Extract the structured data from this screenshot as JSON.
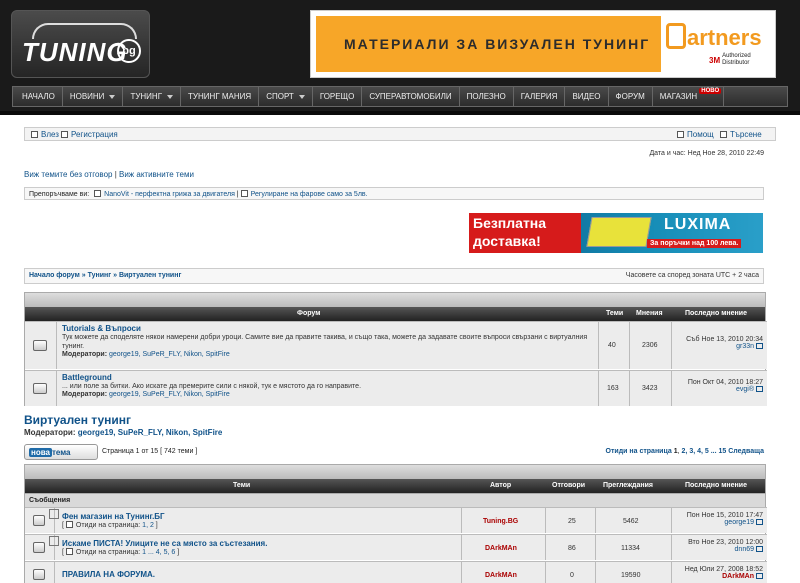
{
  "logo": {
    "text": "TUNING",
    "badge": "bg"
  },
  "banner": {
    "text": "МАТЕРИАЛИ ЗА ВИЗУАЛЕН ТУНИНГ",
    "brand": "artners",
    "brand_sub_strong": "3M",
    "brand_sub": "Authorized Distributor"
  },
  "nav": {
    "items": [
      {
        "label": "НАЧАЛО"
      },
      {
        "label": "НОВИНИ"
      },
      {
        "label": "ТУНИНГ"
      },
      {
        "label": "ТУНИНГ МАНИЯ"
      },
      {
        "label": "СПОРТ"
      },
      {
        "label": "ГОРЕЩО"
      },
      {
        "label": "СУПЕРАВТОМОБИЛИ"
      },
      {
        "label": "ПОЛЕЗНО"
      },
      {
        "label": "ГАЛЕРИЯ"
      },
      {
        "label": "ВИДЕО"
      },
      {
        "label": "ФОРУМ"
      },
      {
        "label": "МАГАЗИН"
      }
    ],
    "new_badge": "НОВО"
  },
  "header": {
    "login": "Влез",
    "register": "Регистрация",
    "help": "Помощ",
    "search": "Търсене"
  },
  "datetime": "Дата и час: Нед Ное 28, 2010 22:49",
  "links": {
    "unanswered": "Виж темите без отговор",
    "separator": " | ",
    "active": "Виж активните теми"
  },
  "recommended": {
    "label": "Препоръчваме ви:",
    "link1": "NanoVit - перфектна грижа за двигателя",
    "link2": "Регулиране на фарове само за 5лв."
  },
  "ad2": {
    "line1": "Безплатна",
    "line2": "доставка!",
    "brand": "LUXIMA",
    "sub": "За поръчки над 100 лева."
  },
  "breadcrumb": {
    "home": "Начало форум",
    "sep": " » ",
    "cat": "Тунинг",
    "forum": "Виртуален тунинг",
    "tz": "Часовете са според зоната UTC + 2 часа"
  },
  "forums_table": {
    "headers": [
      "Форум",
      "Теми",
      "Мнения",
      "Последно мнение"
    ],
    "rows": [
      {
        "title": "Tutorials & Въпроси",
        "desc": "Тук можете да споделяте някои намерени добри уроци. Самите вие да правите такива, и също така, можете да задавате своите въпроси свързани с виртуалния тунинг.",
        "mods_label": "Модератори:",
        "mods": "george19, SuPeR_FLY, Nikon, SpitFire",
        "topics": "40",
        "posts": "2306",
        "last_date": "Съб Ное 13, 2010 20:34",
        "last_user": "gr33n"
      },
      {
        "title": "Battleground",
        "desc": "... или поле за битки. Ако искате да премерите сили с някой, тук е мястото да го направите.",
        "mods_label": "Модератори:",
        "mods": "george19, SuPeR_FLY, Nikon, SpitFire",
        "topics": "163",
        "posts": "3423",
        "last_date": "Пон Окт 04, 2010 18:27",
        "last_user": "evgi®"
      }
    ]
  },
  "forum_title": "Виртуален тунинг",
  "forum_mods": {
    "label": "Модератори:",
    "names": "george19, SuPeR_FLY, Nikon, SpitFire"
  },
  "new_topic": {
    "part1": "нова",
    "part2": "тема"
  },
  "page_info": "Страница 1 от 15  [ 742 теми ]",
  "pagination": {
    "label": "Отиди на страница",
    "current": "1",
    "pages": "2, 3, 4, 5 ... 15",
    "next": "Следваща"
  },
  "topics_table": {
    "headers": [
      "Теми",
      "Автор",
      "Отговори",
      "Преглеждания",
      "Последно мнение"
    ],
    "section": "Съобщения",
    "rows": [
      {
        "title": "Фен магазин на Тунинг.БГ",
        "pages_label": "Отиди на страница:",
        "pages": "1, 2",
        "author": "Tuning.BG",
        "replies": "25",
        "views": "5462",
        "last_date": "Пон Ное 15, 2010 17:47",
        "last_user": "george19"
      },
      {
        "title": "Искаме ПИСТА! Улиците не са място за състезания.",
        "pages_label": "Отиди на страница:",
        "pages": "1 ... 4, 5, 6",
        "author": "DArkMAn",
        "replies": "86",
        "views": "11334",
        "last_date": "Вто Ное 23, 2010 12:00",
        "last_user": "dnn69"
      },
      {
        "title": "ПРАВИЛА НА ФОРУМА.",
        "pages_label": "",
        "pages": "",
        "author": "DArkMAn",
        "replies": "0",
        "views": "19590",
        "last_date": "Нед Юли 27, 2008 18:52",
        "last_user": "DArkMAn"
      }
    ]
  }
}
